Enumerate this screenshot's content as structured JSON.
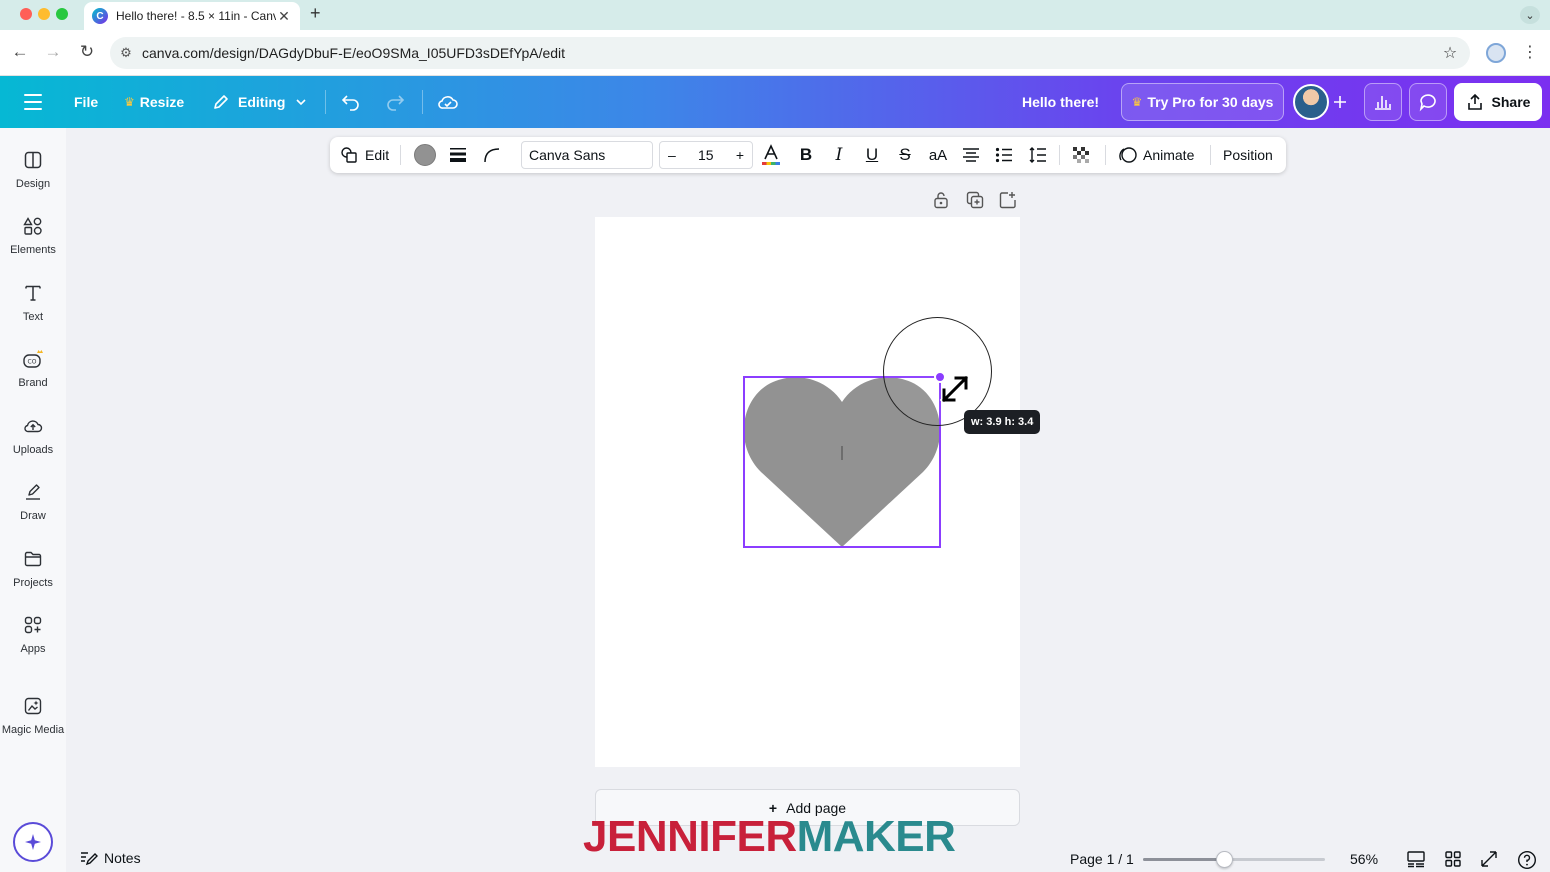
{
  "browser": {
    "tab_title": "Hello there! - 8.5 × 11in - Canva",
    "tab_favicon": "canva-icon",
    "new_tab": "+",
    "url": "canva.com/design/DAGdyDbuF-E/eoO9SMa_I05UFD3sDEfYpA/edit"
  },
  "header": {
    "file_label": "File",
    "resize_label": "Resize",
    "editing_label": "Editing",
    "design_title": "Hello there!",
    "pro_label": "Try Pro for 30 days",
    "share_label": "Share",
    "gradient_start": "#06b8d4",
    "gradient_end": "#7b2ff0"
  },
  "sidebar": {
    "items": [
      {
        "label": "Design",
        "icon": "design-icon"
      },
      {
        "label": "Elements",
        "icon": "elements-icon"
      },
      {
        "label": "Text",
        "icon": "text-icon"
      },
      {
        "label": "Brand",
        "icon": "brand-icon"
      },
      {
        "label": "Uploads",
        "icon": "uploads-icon"
      },
      {
        "label": "Draw",
        "icon": "draw-icon"
      },
      {
        "label": "Projects",
        "icon": "projects-icon"
      },
      {
        "label": "Apps",
        "icon": "apps-icon"
      },
      {
        "label": "Magic Media",
        "icon": "magic-media-icon"
      }
    ]
  },
  "toolbar": {
    "edit_label": "Edit",
    "font_family": "Canva Sans",
    "font_size": "15",
    "decrease": "–",
    "increase": "+",
    "case_label": "aA",
    "animate_label": "Animate",
    "position_label": "Position",
    "fill_color": "#929292"
  },
  "canvas": {
    "dimension_tooltip": "w: 3.9 h: 3.4",
    "add_page_label": "Add page",
    "add_page_plus": "+",
    "shape_color": "#929292",
    "selection_color": "#8b3dff"
  },
  "watermark": {
    "part1": "JENNIFER",
    "part2": "MAKER",
    "color1": "#c8203a",
    "color2": "#2a8a8e"
  },
  "footer": {
    "notes_label": "Notes",
    "page_indicator": "Page 1 / 1",
    "zoom_label": "56%",
    "zoom_fraction": 0.45
  }
}
